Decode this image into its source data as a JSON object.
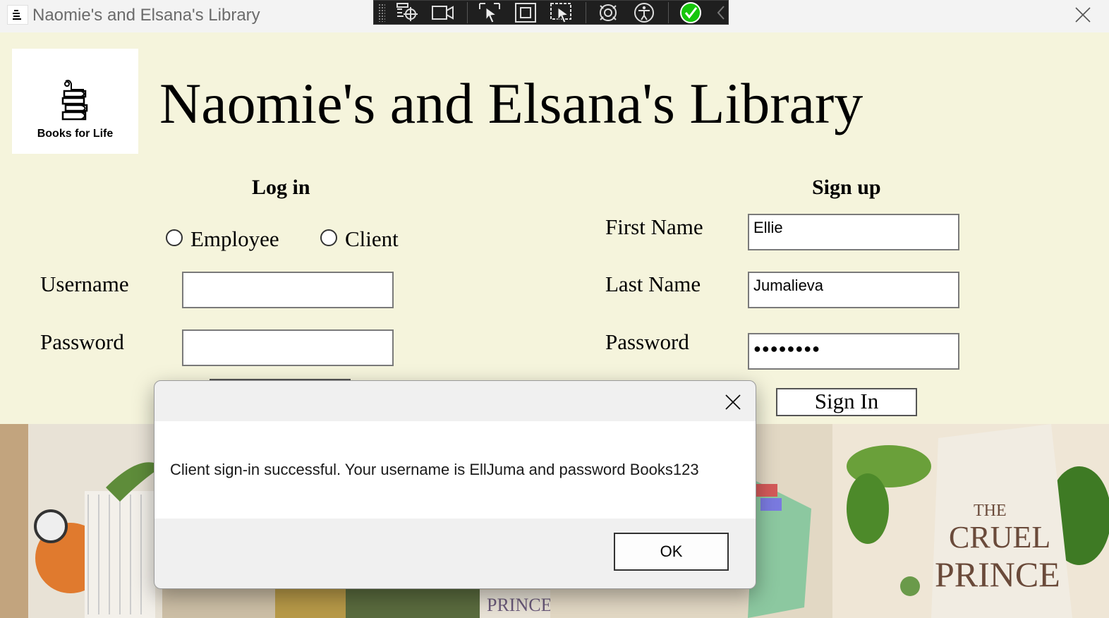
{
  "window": {
    "title": "Naomie's and Elsana's Library",
    "icon": "app-icon",
    "close_icon": "close-icon"
  },
  "debug_toolbar": {
    "tools": [
      "live-visual-tree-icon",
      "video-icon",
      "select-element-icon",
      "display-layout-adorners-icon",
      "track-focus-icon",
      "hot-reload-icon",
      "accessibility-icon",
      "check-icon",
      "collapse-chevron-icon"
    ]
  },
  "header": {
    "logo_text": "Books for Life",
    "title": "Naomie's and Elsana's Library"
  },
  "login": {
    "heading": "Log in",
    "role_options": [
      "Employee",
      "Client"
    ],
    "username_label": "Username",
    "username_value": "",
    "password_label": "Password",
    "password_value": ""
  },
  "signup": {
    "heading": "Sign up",
    "first_name_label": "First Name",
    "first_name_value": "Ellie",
    "last_name_label": "Last Name",
    "last_name_value": "Jumalieva",
    "password_label": "Password",
    "password_masked": "●●●●●●●●",
    "sign_in_label": "Sign In"
  },
  "photo": {
    "book_title_1": "THE",
    "book_title_2": "CRUEL",
    "book_title_3": "PRINCE",
    "spine_text": "PRINCE"
  },
  "dialog": {
    "message": "Client sign-in successful. Your username is EllJuma and password Books123",
    "ok_label": "OK"
  },
  "colors": {
    "background": "#f5f4dc",
    "titlebar": "#f3f3f3",
    "toolbar": "#1f1f1f",
    "check_green": "#16c60c"
  }
}
